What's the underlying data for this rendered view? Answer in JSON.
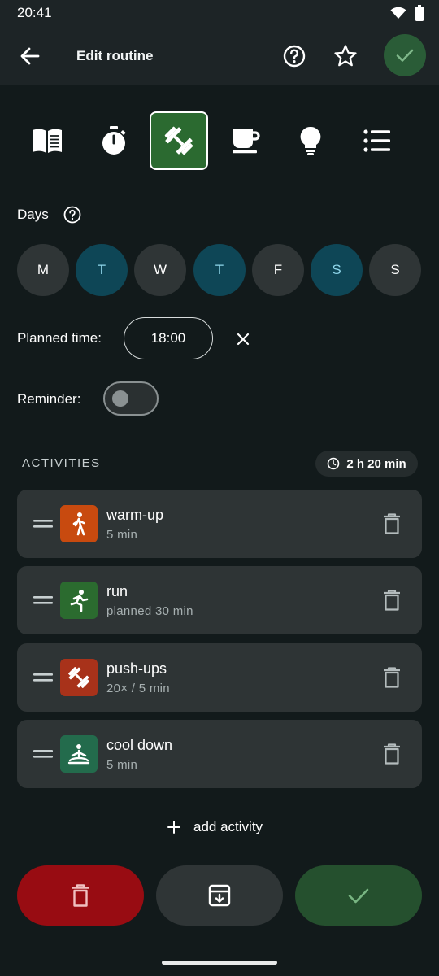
{
  "status_bar": {
    "time": "20:41"
  },
  "app_bar": {
    "title": "Edit routine"
  },
  "categories": [
    {
      "icon": "book-icon",
      "selected": false
    },
    {
      "icon": "stopwatch-icon",
      "selected": false
    },
    {
      "icon": "dumbbell-icon",
      "selected": true
    },
    {
      "icon": "coffee-icon",
      "selected": false
    },
    {
      "icon": "lightbulb-icon",
      "selected": false
    },
    {
      "icon": "list-icon",
      "selected": false
    }
  ],
  "days": {
    "label": "Days",
    "items": [
      {
        "letter": "M",
        "active": false
      },
      {
        "letter": "T",
        "active": true
      },
      {
        "letter": "W",
        "active": false
      },
      {
        "letter": "T",
        "active": true
      },
      {
        "letter": "F",
        "active": false
      },
      {
        "letter": "S",
        "active": true
      },
      {
        "letter": "S",
        "active": false
      }
    ]
  },
  "planned_time": {
    "label": "Planned time:",
    "value": "18:00"
  },
  "reminder": {
    "label": "Reminder:",
    "enabled": false
  },
  "activities": {
    "header": "ACTIVITIES",
    "total_duration": "2 h 20 min",
    "items": [
      {
        "title": "warm-up",
        "subtitle": "5 min",
        "icon": "walking-person-icon",
        "color": "#c84a0f"
      },
      {
        "title": "run",
        "subtitle": "planned 30 min",
        "icon": "running-person-icon",
        "color": "#2b6b2f"
      },
      {
        "title": "push-ups",
        "subtitle": "20× / 5 min",
        "icon": "dumbbell-icon",
        "color": "#a8321a"
      },
      {
        "title": "cool down",
        "subtitle": "5 min",
        "icon": "meditation-icon",
        "color": "#236b4c"
      }
    ],
    "add_label": "add activity"
  },
  "colors": {
    "background": "#121a1b",
    "app_bar": "#1d2426",
    "accent_green": "#2b6a30",
    "active_day": "#0e4656",
    "delete_red": "#980c12",
    "confirm_green": "#25502e"
  }
}
